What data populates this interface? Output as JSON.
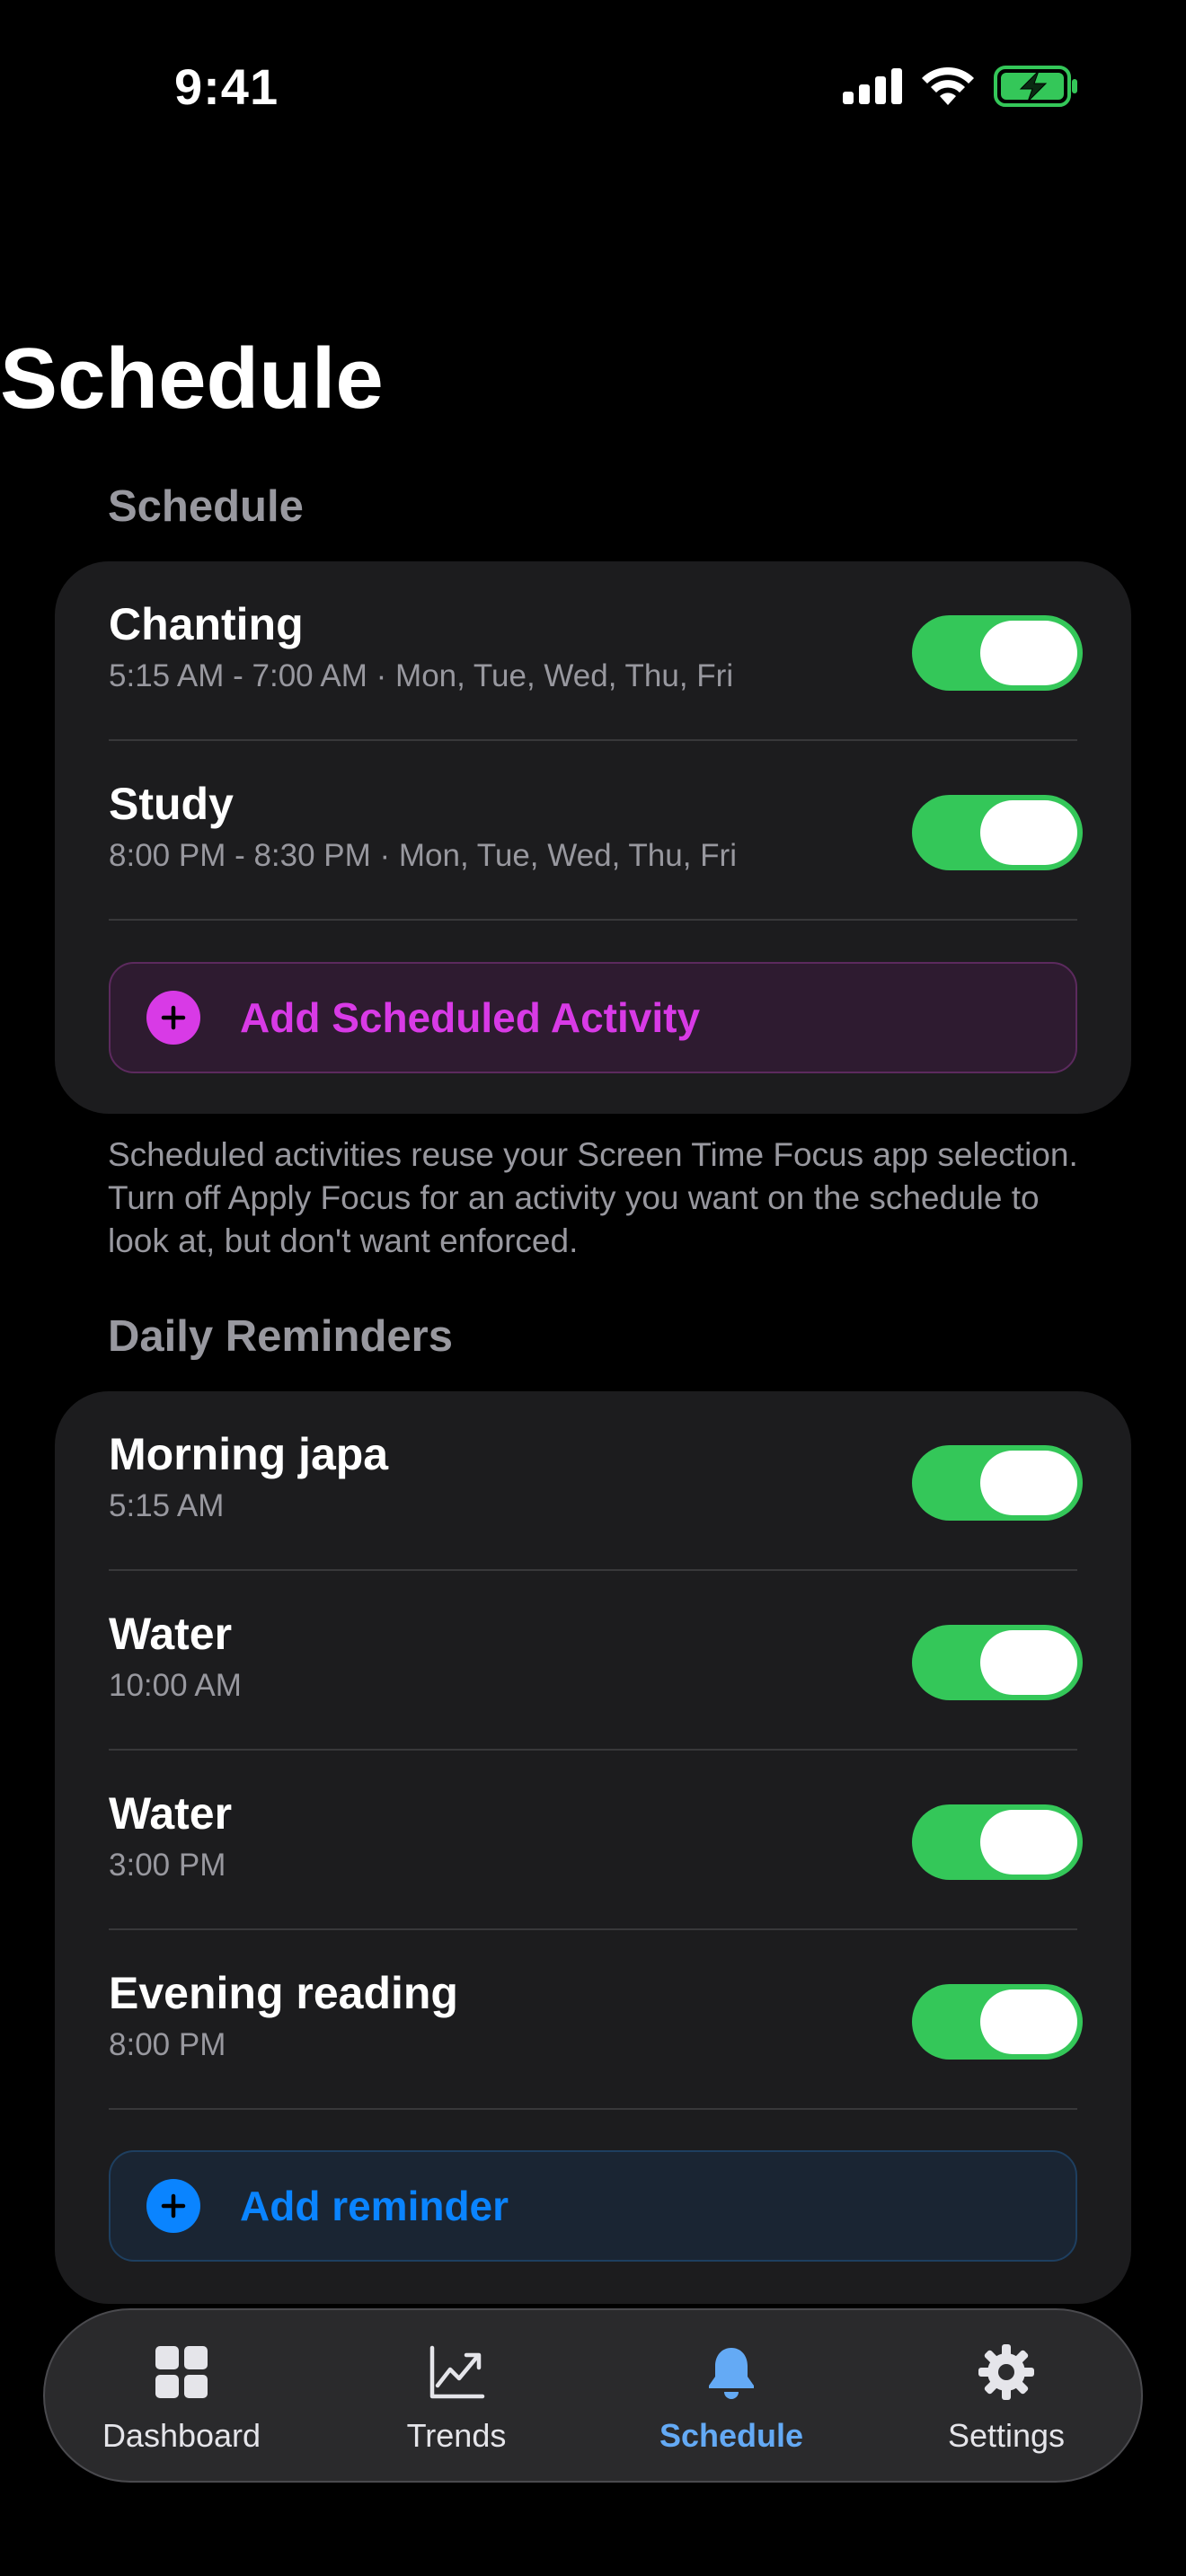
{
  "status_bar": {
    "time": "9:41"
  },
  "page": {
    "large_title": "Schedule"
  },
  "schedule_section": {
    "header": "Schedule",
    "items": [
      {
        "title": "Chanting",
        "subtitle": "5:15 AM - 7:00 AM · Mon, Tue, Wed, Thu, Fri",
        "enabled": true
      },
      {
        "title": "Study",
        "subtitle": "8:00 PM - 8:30 PM · Mon, Tue, Wed, Thu, Fri",
        "enabled": true
      }
    ],
    "add_label": "Add Scheduled Activity",
    "footer": "Scheduled activities reuse your Screen Time Focus app selection. Turn off Apply Focus for an activity you want on the schedule to look at, but don't want enforced."
  },
  "reminders_section": {
    "header": "Daily Reminders",
    "items": [
      {
        "title": "Morning japa",
        "subtitle": "5:15 AM",
        "enabled": true
      },
      {
        "title": "Water",
        "subtitle": "10:00 AM",
        "enabled": true
      },
      {
        "title": "Water",
        "subtitle": "3:00 PM",
        "enabled": true
      },
      {
        "title": "Evening reading",
        "subtitle": "8:00 PM",
        "enabled": true
      }
    ],
    "add_label": "Add reminder"
  },
  "tab_bar": {
    "active": "Schedule",
    "tabs": [
      {
        "label": "Dashboard",
        "icon": "grid-icon"
      },
      {
        "label": "Trends",
        "icon": "chart-line-icon"
      },
      {
        "label": "Schedule",
        "icon": "bell-icon"
      },
      {
        "label": "Settings",
        "icon": "gear-icon"
      }
    ]
  },
  "colors": {
    "background": "#000000",
    "card": "#1c1c1e",
    "toggle_on": "#34c759",
    "secondary_text": "#98989f",
    "activity_accent": "#d83ae6",
    "reminder_accent": "#0a84ff",
    "active_tab": "#64aaf5"
  }
}
